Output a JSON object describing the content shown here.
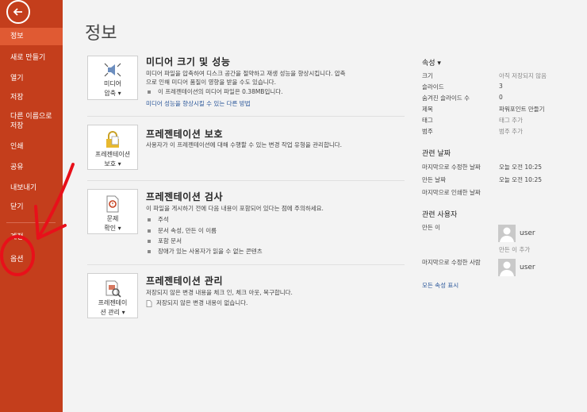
{
  "sidebar": {
    "items": [
      {
        "label": "정보"
      },
      {
        "label": "새로 만들기"
      },
      {
        "label": "열기"
      },
      {
        "label": "저장"
      },
      {
        "label": "다른 이름으로 저장"
      },
      {
        "label": "인쇄"
      },
      {
        "label": "공유"
      },
      {
        "label": "내보내기"
      },
      {
        "label": "닫기"
      },
      {
        "label": "계정"
      },
      {
        "label": "옵션"
      }
    ]
  },
  "main": {
    "title": "정보",
    "sections": [
      {
        "icon": "media-speaker-icon",
        "icon_caption_1": "미디어",
        "icon_caption_2": "압축",
        "title": "미디어 크기 및 성능",
        "desc_1": "미디어 파일을 압축하여 디스크 공간을 절약하고 재생 성능을 향상시킵니다. 압축",
        "desc_2": "으로 인해 미디어 품질이 영향을 받을 수도 있습니다.",
        "bullet": "이 프레젠테이션의 미디어 파일은 0.38MB입니다.",
        "link": "미디어 성능을 향상시킬 수 있는 다른 방법"
      },
      {
        "icon": "lock-icon",
        "icon_caption_1": "프레젠테이션",
        "icon_caption_2": "보호",
        "title": "프레젠테이션 보호",
        "desc_1": "사용자가 이 프레젠테이션에 대해 수행할 수 있는 변경 작업 유형을 관리합니다."
      },
      {
        "icon": "inspect-document-icon",
        "icon_caption_1": "문제",
        "icon_caption_2": "확인",
        "title": "프레젠테이션 검사",
        "desc_1": "이 파일을 게시하기 전에 다음 내용이 포함되어 있다는 점에 주의하세요.",
        "bullets": [
          "주석",
          "문서 속성, 만든 이 이름",
          "포함 문서",
          "장애가 있는 사용자가 읽을 수 없는 콘텐츠"
        ]
      },
      {
        "icon": "manage-presentation-icon",
        "icon_caption_1": "프레젠테이",
        "icon_caption_2": "션 관리",
        "title": "프레젠테이션 관리",
        "desc_1": "저장되지 않은 변경 내용을 체크 인, 체크 아웃, 복구합니다.",
        "note": "저장되지 않은 변경 내용이 없습니다."
      }
    ]
  },
  "properties": {
    "header": "속성",
    "rows": [
      {
        "label": "크기",
        "value": "아직 저장되지 않음"
      },
      {
        "label": "슬라이드",
        "value": "3"
      },
      {
        "label": "숨겨진 슬라이드 수",
        "value": "0"
      },
      {
        "label": "제목",
        "value": "파워포인트 만들기"
      },
      {
        "label": "태그",
        "value": "태그 추가"
      },
      {
        "label": "범주",
        "value": "범주 추가"
      }
    ],
    "dates_header": "관련 날짜",
    "dates": [
      {
        "label": "마지막으로 수정한 날짜",
        "value": "오늘 오전 10:25"
      },
      {
        "label": "만든 날짜",
        "value": "오늘 오전 10:25"
      },
      {
        "label": "마지막으로 인쇄한 날짜",
        "value": ""
      }
    ],
    "people_header": "관련 사용자",
    "author_label": "만든 이",
    "author_name": "user",
    "add_author": "만든 이 추가",
    "modifier_label": "마지막으로 수정한 사람",
    "modifier_name": "user",
    "show_all": "모든 속성 표시"
  }
}
